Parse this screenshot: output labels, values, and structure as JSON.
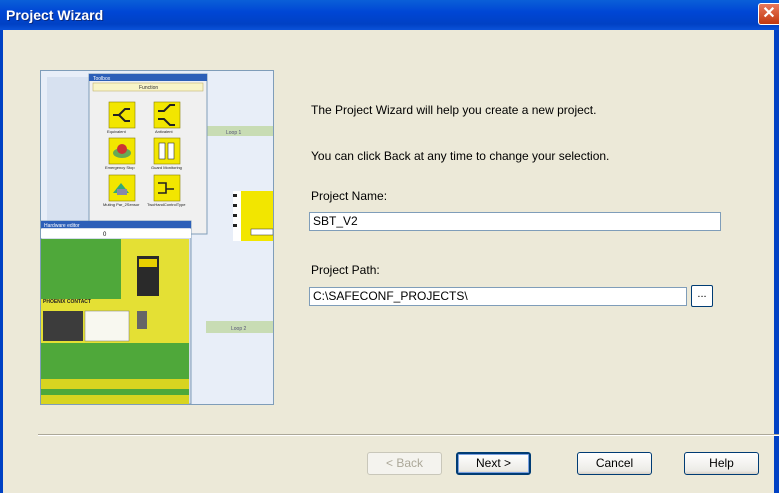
{
  "window": {
    "title": "Project Wizard",
    "close_glyph": "✕"
  },
  "intro": {
    "line1": "The Project Wizard will help you create a new project.",
    "line2": "You can click Back at any time to change your selection."
  },
  "project_name": {
    "label": "Project Name:",
    "value": "SBT_V2"
  },
  "project_path": {
    "label": "Project Path:",
    "value": "C:\\SAFECONF_PROJECTS\\",
    "browse_label": "..."
  },
  "buttons": {
    "back": "< Back",
    "next": "Next >",
    "cancel": "Cancel",
    "help": "Help"
  },
  "preview": {
    "toolbox_title": "Toolbox",
    "toolbox_header": "Function",
    "items": [
      "Equivalent",
      "Antivalent",
      "Emergency Stop",
      "Guard Monitoring",
      "Muting Par_2Sensor",
      "TwoHandControlType"
    ],
    "loop1": "Loop 1",
    "loop2": "Loop 2",
    "hw_editor": "Hardware editor",
    "brand": "PHOENIX CONTACT"
  },
  "colors": {
    "title_bar": "#0046d5",
    "dialog_bg": "#ece9d8",
    "accent_yellow": "#f2e600"
  }
}
